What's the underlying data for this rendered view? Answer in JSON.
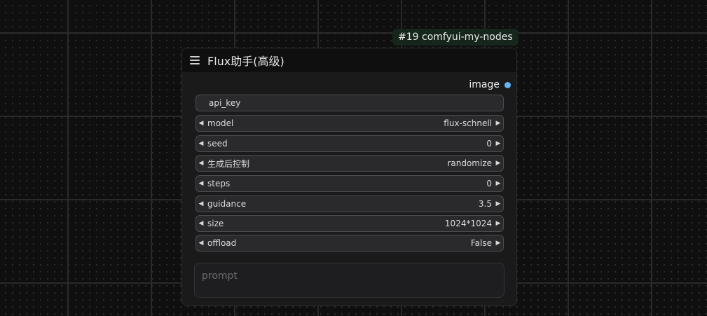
{
  "badge": "#19 comfyui-my-nodes",
  "node": {
    "title": "Flux助手(高级)",
    "output_label": "image",
    "api_key_label": "api_key",
    "widgets": [
      {
        "label": "model",
        "value": "flux-schnell"
      },
      {
        "label": "seed",
        "value": "0"
      },
      {
        "label": "生成后控制",
        "value": "randomize"
      },
      {
        "label": "steps",
        "value": "0"
      },
      {
        "label": "guidance",
        "value": "3.5"
      },
      {
        "label": "size",
        "value": "1024*1024"
      },
      {
        "label": "offload",
        "value": "False"
      }
    ],
    "prompt_placeholder": "prompt"
  },
  "colors": {
    "output_dot": "#64b5f6",
    "badge_bg": "#16261c"
  }
}
